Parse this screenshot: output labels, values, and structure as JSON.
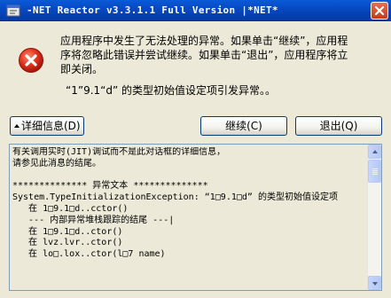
{
  "window": {
    "title": "-NET Reactor v3.3.1.1 Full Version |*NET*",
    "colors": {
      "titlebar": "#0a5ad8",
      "dialog_bg": "#ece9d8",
      "error_red": "#d7281e"
    }
  },
  "icons": {
    "app": "app-icon",
    "close": "close-icon",
    "error": "error-icon",
    "details_arrow": "arrow-up-icon"
  },
  "message": {
    "line1": "应用程序中发生了无法处理的异常。如果单击“继续”，应用程",
    "line2": "序将忽略此错误并尝试继续。如果单击“退出”，应用程序将立",
    "line3": "即关闭。",
    "exception_line": "“1”9.1“d” 的类型初始值设定项引发异常。。"
  },
  "buttons": {
    "details": "详细信息(D)",
    "continue": "继续(C)",
    "exit": "退出(Q)"
  },
  "details_lines": [
    "有关调用实时(JIT)调试而不是此对话框的详细信息，",
    "请参见此消息的结尾。",
    "",
    "************** 异常文本 **************",
    "System.TypeInitializationException: “1□9.1□d” 的类型初始值设定项",
    "   在 1□9.1□d..cctor()",
    "   --- 内部异常堆栈跟踪的结尾 ---|",
    "   在 1□9.1□d..ctor()",
    "   在 lvz.lvr..ctor()",
    "   在 lo□.lox..ctor(l□7 name)"
  ]
}
